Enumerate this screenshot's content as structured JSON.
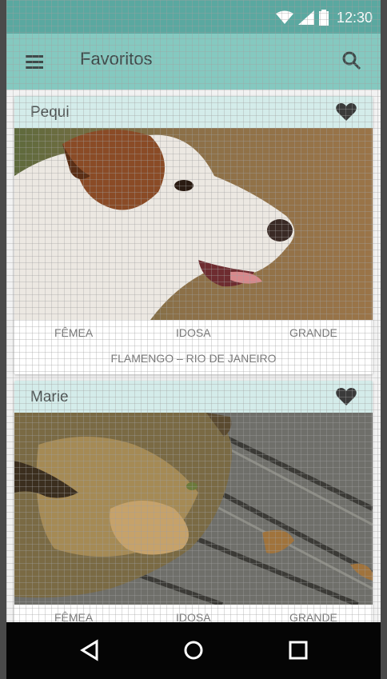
{
  "status_bar": {
    "time": "12:30",
    "icons": [
      "wifi-icon",
      "signal-icon",
      "battery-icon"
    ]
  },
  "app_bar": {
    "title": "Favoritos",
    "menu_icon": "menu-icon",
    "search_icon": "search-icon",
    "color": "#85c9c0"
  },
  "cards": [
    {
      "name": "Pequi",
      "favorite_icon": "heart-icon",
      "image_subject": "dog",
      "attributes": [
        "FÊMEA",
        "IDOSA",
        "GRANDE"
      ],
      "location": "FLAMENGO – RIO DE JANEIRO"
    },
    {
      "name": "Marie",
      "favorite_icon": "heart-icon",
      "image_subject": "cat",
      "attributes": [
        "FÊMEA",
        "IDOSA",
        "GRANDE"
      ]
    }
  ],
  "nav_bar": {
    "buttons": [
      "back-icon",
      "home-icon",
      "recents-icon"
    ]
  }
}
